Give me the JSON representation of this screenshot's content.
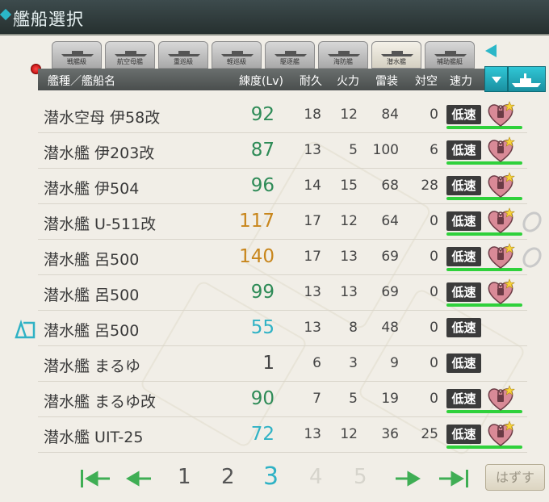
{
  "window": {
    "title": "艦船選択"
  },
  "tabs": [
    {
      "label": "戦艦級",
      "active": false
    },
    {
      "label": "航空母艦",
      "active": false
    },
    {
      "label": "重巡級",
      "active": false
    },
    {
      "label": "軽巡級",
      "active": false
    },
    {
      "label": "駆逐艦",
      "active": false
    },
    {
      "label": "海防艦",
      "active": false
    },
    {
      "label": "潜水艦",
      "active": true
    },
    {
      "label": "補助艦艇",
      "active": false
    }
  ],
  "header": {
    "name": "艦種／艦船名",
    "level": "練度(Lv)",
    "hp": "耐久",
    "firepower": "火力",
    "torpedo": "雷装",
    "aa": "対空",
    "speed": "速力"
  },
  "ships": [
    {
      "name": "潜水空母 伊58改",
      "level": "92",
      "level_color": "#2e8b57",
      "hp": "18",
      "firepower": "12",
      "torpedo": "84",
      "aa": "0",
      "speed": "低速",
      "heart": true,
      "ring": false
    },
    {
      "name": "潜水艦 伊203改",
      "level": "87",
      "level_color": "#2e8b57",
      "hp": "13",
      "firepower": "5",
      "torpedo": "100",
      "aa": "6",
      "speed": "低速",
      "heart": true,
      "ring": false
    },
    {
      "name": "潜水艦 伊504",
      "level": "96",
      "level_color": "#2e8b57",
      "hp": "14",
      "firepower": "15",
      "torpedo": "68",
      "aa": "28",
      "speed": "低速",
      "heart": true,
      "ring": false
    },
    {
      "name": "潜水艦 U-511改",
      "level": "117",
      "level_color": "#c8861c",
      "hp": "17",
      "firepower": "12",
      "torpedo": "64",
      "aa": "0",
      "speed": "低速",
      "heart": true,
      "ring": true
    },
    {
      "name": "潜水艦 呂500",
      "level": "140",
      "level_color": "#c8861c",
      "hp": "17",
      "firepower": "13",
      "torpedo": "69",
      "aa": "0",
      "speed": "低速",
      "heart": true,
      "ring": true
    },
    {
      "name": "潜水艦 呂500",
      "level": "99",
      "level_color": "#2e8b57",
      "hp": "13",
      "firepower": "13",
      "torpedo": "69",
      "aa": "0",
      "speed": "低速",
      "heart": true,
      "ring": false
    },
    {
      "name": "潜水艦 呂500",
      "level": "55",
      "level_color": "#2fb2c5",
      "hp": "13",
      "firepower": "8",
      "torpedo": "48",
      "aa": "0",
      "speed": "低速",
      "heart": false,
      "ring": false
    },
    {
      "name": "潜水艦 まるゆ",
      "level": "1",
      "level_color": "#444444",
      "hp": "6",
      "firepower": "3",
      "torpedo": "9",
      "aa": "0",
      "speed": "低速",
      "heart": false,
      "ring": false
    },
    {
      "name": "潜水艦 まるゆ改",
      "level": "90",
      "level_color": "#2e8b57",
      "hp": "7",
      "firepower": "5",
      "torpedo": "19",
      "aa": "0",
      "speed": "低速",
      "heart": true,
      "ring": false
    },
    {
      "name": "潜水艦 UIT-25",
      "level": "72",
      "level_color": "#2fb2c5",
      "hp": "13",
      "firepower": "12",
      "torpedo": "36",
      "aa": "25",
      "speed": "低速",
      "heart": true,
      "ring": false
    }
  ],
  "pagination": {
    "pages": [
      "1",
      "2",
      "3",
      "4",
      "5"
    ],
    "current": "3",
    "unset_label": "はずす"
  },
  "icons": {
    "sort": "triangle-down-icon",
    "ship_type": "ship-silhouette-icon",
    "heart": "heart-lock-icon",
    "ring": "wedding-ring-icon"
  }
}
